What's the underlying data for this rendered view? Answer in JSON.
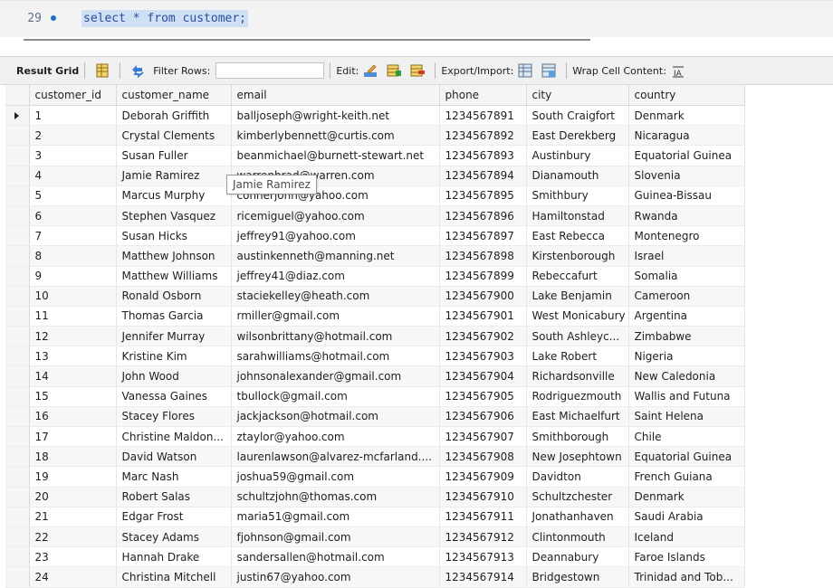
{
  "editor": {
    "line_number": "29",
    "sql": "select * from customer;"
  },
  "toolbar": {
    "result_grid_label": "Result Grid",
    "filter_rows_label": "Filter Rows:",
    "filter_rows_value": "",
    "edit_label": "Edit:",
    "export_import_label": "Export/Import:",
    "wrap_cell_label": "Wrap Cell Content:",
    "icons": [
      "grid-view-icon",
      "refresh-icon",
      "edit-row-icon",
      "add-row-icon",
      "delete-row-icon",
      "export-icon",
      "import-icon",
      "wrap-text-icon"
    ]
  },
  "grid": {
    "columns": [
      "customer_id",
      "customer_name",
      "email",
      "phone",
      "city",
      "country"
    ],
    "rows": [
      [
        "1",
        "Deborah Griffith",
        "balljoseph@wright-keith.net",
        "1234567891",
        "South Craigfort",
        "Denmark"
      ],
      [
        "2",
        "Crystal Clements",
        "kimberlybennett@curtis.com",
        "1234567892",
        "East Derekberg",
        "Nicaragua"
      ],
      [
        "3",
        "Susan Fuller",
        "beanmichael@burnett-stewart.net",
        "1234567893",
        "Austinbury",
        "Equatorial Guinea"
      ],
      [
        "4",
        "Jamie Ramirez",
        "warrenbrad@warren.com",
        "1234567894",
        "Dianamouth",
        "Slovenia"
      ],
      [
        "5",
        "Marcus Murphy",
        "connerjohn@yahoo.com",
        "1234567895",
        "Smithbury",
        "Guinea-Bissau"
      ],
      [
        "6",
        "Stephen Vasquez",
        "ricemiguel@yahoo.com",
        "1234567896",
        "Hamiltonstad",
        "Rwanda"
      ],
      [
        "7",
        "Susan Hicks",
        "jeffrey91@yahoo.com",
        "1234567897",
        "East Rebecca",
        "Montenegro"
      ],
      [
        "8",
        "Matthew Johnson",
        "austinkenneth@manning.net",
        "1234567898",
        "Kirstenborough",
        "Israel"
      ],
      [
        "9",
        "Matthew Williams",
        "jeffrey41@diaz.com",
        "1234567899",
        "Rebeccafurt",
        "Somalia"
      ],
      [
        "10",
        "Ronald Osborn",
        "staciekelley@heath.com",
        "1234567900",
        "Lake Benjamin",
        "Cameroon"
      ],
      [
        "11",
        "Thomas Garcia",
        "rmiller@gmail.com",
        "1234567901",
        "West Monicabury",
        "Argentina"
      ],
      [
        "12",
        "Jennifer Murray",
        "wilsonbrittany@hotmail.com",
        "1234567902",
        "South Ashleyc...",
        "Zimbabwe"
      ],
      [
        "13",
        "Kristine Kim",
        "sarahwilliams@hotmail.com",
        "1234567903",
        "Lake Robert",
        "Nigeria"
      ],
      [
        "14",
        "John Wood",
        "johnsonalexander@gmail.com",
        "1234567904",
        "Richardsonville",
        "New Caledonia"
      ],
      [
        "15",
        "Vanessa Gaines",
        "tbullock@gmail.com",
        "1234567905",
        "Rodriguezmouth",
        "Wallis and Futuna"
      ],
      [
        "16",
        "Stacey Flores",
        "jackjackson@hotmail.com",
        "1234567906",
        "East Michaelfurt",
        "Saint Helena"
      ],
      [
        "17",
        "Christine Maldon...",
        "ztaylor@yahoo.com",
        "1234567907",
        "Smithborough",
        "Chile"
      ],
      [
        "18",
        "David Watson",
        "laurenlawson@alvarez-mcfarland....",
        "1234567908",
        "New Josephtown",
        "Equatorial Guinea"
      ],
      [
        "19",
        "Marc Nash",
        "joshua59@gmail.com",
        "1234567909",
        "Davidton",
        "French Guiana"
      ],
      [
        "20",
        "Robert Salas",
        "schultzjohn@thomas.com",
        "1234567910",
        "Schultzchester",
        "Denmark"
      ],
      [
        "21",
        "Edgar Frost",
        "maria51@gmail.com",
        "1234567911",
        "Jonathanhaven",
        "Saudi Arabia"
      ],
      [
        "22",
        "Stacey Adams",
        "fjohnson@gmail.com",
        "1234567912",
        "Clintonmouth",
        "Iceland"
      ],
      [
        "23",
        "Hannah Drake",
        "sandersallen@hotmail.com",
        "1234567913",
        "Deannabury",
        "Faroe Islands"
      ],
      [
        "24",
        "Christina Mitchell",
        "justin67@yahoo.com",
        "1234567914",
        "Bridgestown",
        "Trinidad and Tob..."
      ]
    ]
  },
  "tooltip": {
    "text": "Jamie Ramirez"
  }
}
